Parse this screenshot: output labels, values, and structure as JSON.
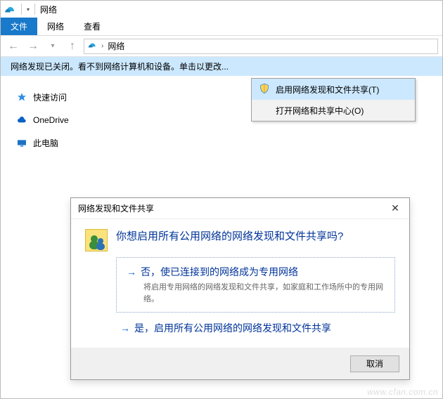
{
  "titlebar": {
    "title": "网络"
  },
  "ribbon": {
    "file": "文件",
    "network": "网络",
    "view": "查看"
  },
  "address": {
    "location": "网络"
  },
  "warning": {
    "text": "网络发现已关闭。看不到网络计算机和设备。单击以更改..."
  },
  "sidebar": {
    "quick": "快速访问",
    "onedrive": "OneDrive",
    "thispc": "此电脑"
  },
  "contextmenu": {
    "enable": "启用网络发现和文件共享(T)",
    "opencenter": "打开网络和共享中心(O)"
  },
  "dialog": {
    "title": "网络发现和文件共享",
    "question": "你想启用所有公用网络的网络发现和文件共享吗?",
    "opt1_title": "否，使已连接到的网络成为专用网络",
    "opt1_sub": "将启用专用网络的网络发现和文件共享，如家庭和工作场所中的专用网络。",
    "opt2_title": "是，启用所有公用网络的网络发现和文件共享",
    "cancel": "取消"
  },
  "watermark": "www.cfan.com.cn"
}
